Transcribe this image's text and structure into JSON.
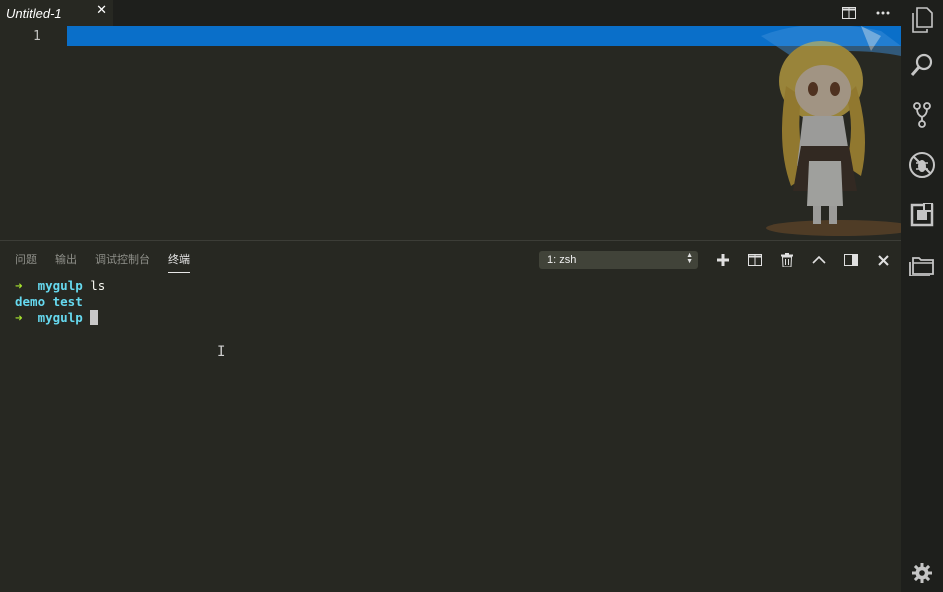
{
  "tab": {
    "title": "Untitled-1",
    "close_glyph": "✕"
  },
  "editor": {
    "line_numbers": [
      "1"
    ]
  },
  "editor_actions": [
    {
      "name": "split-editor-icon"
    },
    {
      "name": "more-actions-icon"
    }
  ],
  "panel": {
    "tabs": [
      {
        "label": "问题",
        "active": false
      },
      {
        "label": "输出",
        "active": false
      },
      {
        "label": "调试控制台",
        "active": false
      },
      {
        "label": "终端",
        "active": true
      }
    ],
    "terminal_selector": {
      "value": "1: zsh"
    },
    "actions": [
      "add-terminal-icon",
      "split-terminal-icon",
      "kill-terminal-icon",
      "maximize-panel-icon",
      "toggle-panel-position-icon",
      "close-panel-icon"
    ]
  },
  "terminal": {
    "lines": [
      {
        "arrow": "➜",
        "dir": "mygulp",
        "cmd": "ls"
      },
      {
        "output": "demo test"
      },
      {
        "arrow": "➜",
        "dir": "mygulp",
        "cmd": ""
      }
    ]
  },
  "activity_bar": [
    "explorer-icon",
    "search-icon",
    "source-control-icon",
    "debug-icon",
    "extensions-icon",
    "folder-icon",
    "settings-gear-icon"
  ],
  "colors": {
    "background": "#272822",
    "current_line_highlight": "#0a6fc9",
    "prompt_arrow": "#a6e22e",
    "prompt_dir": "#66d9ef"
  }
}
